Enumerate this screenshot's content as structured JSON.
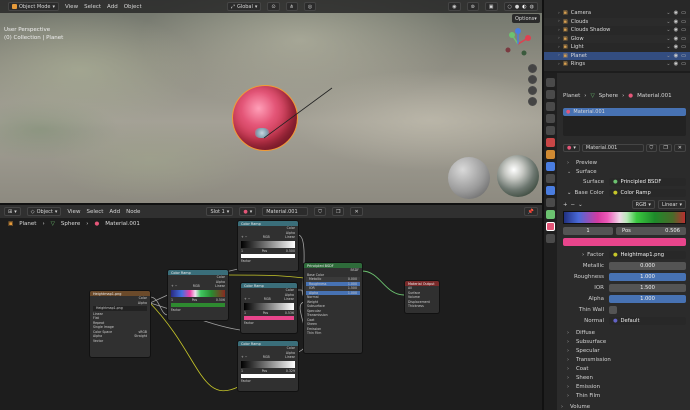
{
  "viewport": {
    "header": {
      "mode": "Object Mode",
      "menus": [
        "View",
        "Select",
        "Add",
        "Object"
      ],
      "transform_orientation": "Global",
      "options": "Options"
    },
    "overlay": {
      "view_name": "User Perspective",
      "collection": "(0) Collection | Planet"
    }
  },
  "outliner": {
    "items": [
      {
        "label": "Camera",
        "color": "#d8a050",
        "selected": false
      },
      {
        "label": "Clouds",
        "color": "#d8a050",
        "selected": false
      },
      {
        "label": "Clouds Shadow",
        "color": "#d8a050",
        "selected": false
      },
      {
        "label": "Glow",
        "color": "#d8a050",
        "selected": false
      },
      {
        "label": "Light",
        "color": "#d8a050",
        "selected": false
      },
      {
        "label": "Planet",
        "color": "#d8a050",
        "selected": true
      },
      {
        "label": "Rings",
        "color": "#d8a050",
        "selected": false
      }
    ]
  },
  "properties": {
    "breadcrumb": {
      "obj": "Planet",
      "mesh": "Sphere",
      "mat": "Material.001"
    },
    "slot_name": "Material.001",
    "material_name": "Material.001",
    "preview_label": "Preview",
    "surface_label": "Surface",
    "surface_field_label": "Surface",
    "surface_value": "Principled BSDF",
    "base_color_label": "Base Color",
    "base_color_value": "Color Ramp",
    "ramp_mode": "RGB",
    "ramp_interp": "Linear",
    "stop_index": "1",
    "pos_label": "Pos",
    "pos_value": "0.506",
    "factor_label": "Factor",
    "factor_value": "Heightmap1.png",
    "metallic_label": "Metallic",
    "metallic_value": "0.000",
    "roughness_label": "Roughness",
    "roughness_value": "1.000",
    "ior_label": "IOR",
    "ior_value": "1.500",
    "alpha_label": "Alpha",
    "alpha_value": "1.000",
    "thinwall_label": "Thin Wall",
    "normal_label": "Normal",
    "normal_value": "Default",
    "sections": [
      "Diffuse",
      "Subsurface",
      "Specular",
      "Transmission",
      "Coat",
      "Sheen",
      "Emission",
      "Thin Film"
    ],
    "volume_label": "Volume"
  },
  "node_editor": {
    "header": {
      "type": "Object",
      "menus": [
        "View",
        "Select",
        "Add",
        "Node"
      ],
      "slot": "Slot 1",
      "material": "Material.001"
    },
    "breadcrumb": {
      "obj": "Planet",
      "mesh": "Sphere",
      "mat": "Material.001"
    },
    "nodes": {
      "image": {
        "title": "Heightmap1.png",
        "file": "Heightmap1.png",
        "rows": [
          "Linear",
          "Flat",
          "Repeat",
          "Single Image",
          "Color Space",
          "sRGB",
          "Alpha",
          "Straight",
          "Vector"
        ]
      },
      "ramp1": {
        "title": "Color Ramp",
        "mode": "RGB",
        "interp": "Linear",
        "out1": "Color",
        "out2": "Alpha",
        "pos": "0.506",
        "in": "Factor"
      },
      "ramp_top": {
        "title": "Color Ramp",
        "mode": "RGB",
        "interp": "Linear",
        "out1": "Color",
        "out2": "Alpha",
        "pos": "0.500",
        "in": "Factor"
      },
      "ramp_mid": {
        "title": "Color Ramp",
        "mode": "RGB",
        "interp": "Linear",
        "out1": "Color",
        "out2": "Alpha",
        "pos": "0.536",
        "in": "Factor"
      },
      "ramp_bot": {
        "title": "Color Ramp",
        "mode": "RGB",
        "interp": "Linear",
        "out1": "Color",
        "out2": "Alpha",
        "pos": "0.329",
        "in": "Factor"
      },
      "bsdf": {
        "title": "Principled BSDF",
        "out": "BSDF",
        "rows": [
          "Base Color",
          "Metallic",
          "Roughness",
          "IOR",
          "Alpha",
          "Normal",
          "Weight",
          "Subsurface",
          "Specular",
          "Transmission",
          "Coat",
          "Sheen",
          "Emission",
          "Thin Film"
        ],
        "values": {
          "Metallic": "0.000",
          "Roughness": "1.000",
          "IOR": "1.500",
          "Alpha": "1.000"
        }
      },
      "output": {
        "title": "Material Output",
        "mode": "All",
        "rows": [
          "Surface",
          "Volume",
          "Displacement",
          "Thickness"
        ]
      }
    }
  },
  "colors": {
    "accent": "#4772b3",
    "header": "#303030",
    "ramp_stop_pink": "#e8458c",
    "node_link": "#c7c729",
    "node_link_green": "#6cc270"
  }
}
